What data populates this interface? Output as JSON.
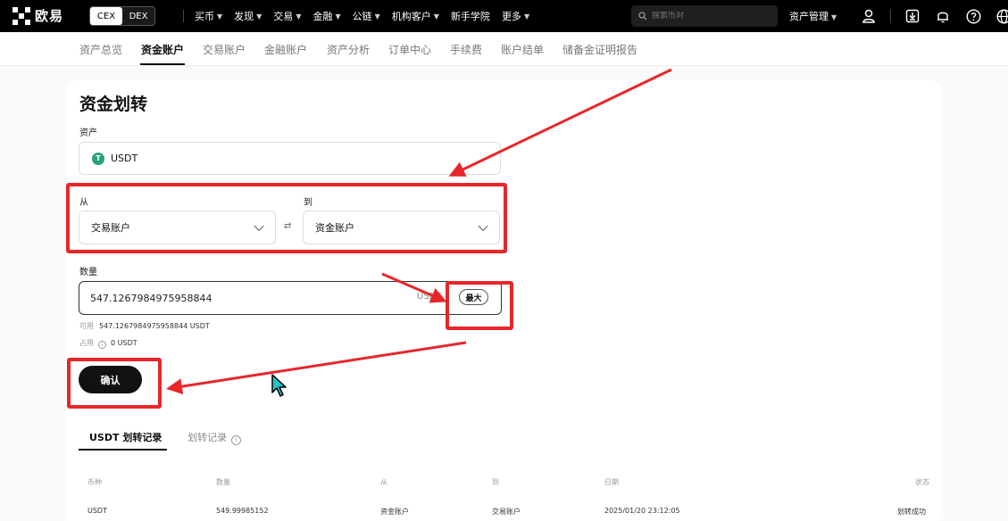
{
  "brand": {
    "name": "欧易"
  },
  "mode_toggle": {
    "cex": "CEX",
    "dex": "DEX"
  },
  "top_menu": [
    {
      "label": "买币",
      "chevron": true
    },
    {
      "label": "发现",
      "chevron": true
    },
    {
      "label": "交易",
      "chevron": true
    },
    {
      "label": "金融",
      "chevron": true
    },
    {
      "label": "公链",
      "chevron": true
    },
    {
      "label": "机构客户",
      "chevron": true
    },
    {
      "label": "新手学院",
      "chevron": false
    },
    {
      "label": "更多",
      "chevron": true
    }
  ],
  "search": {
    "placeholder": "搜索币对"
  },
  "asset_management": "资产管理",
  "nav_icons": [
    "user-icon",
    "download-icon",
    "bell-icon",
    "help-icon",
    "globe-icon"
  ],
  "sub_nav": [
    "资产总览",
    "资金账户",
    "交易账户",
    "金融账户",
    "资产分析",
    "订单中心",
    "手续费",
    "账户结单",
    "储备金证明报告"
  ],
  "sub_nav_active": "资金账户",
  "transfer": {
    "title": "资金划转",
    "asset_label": "资产",
    "asset_value": "USDT",
    "asset_icon_letter": "T",
    "from_label": "从",
    "from_value": "交易账户",
    "to_label": "到",
    "to_value": "资金账户",
    "swap_symbol": "⇄",
    "amount_label": "数量",
    "amount_value": "547.1267984975958844",
    "amount_unit": "USDT",
    "max_button": "最大",
    "available_label": "可用",
    "available_value": "547.1267984975958844 USDT",
    "occupied_label": "占用",
    "occupied_value": "0 USDT",
    "confirm_button": "确认"
  },
  "history": {
    "tabs": [
      "USDT 划转记录",
      "划转记录"
    ],
    "columns": [
      "币种",
      "数量",
      "从",
      "到",
      "日期",
      "状态"
    ],
    "rows": [
      [
        "USDT",
        "549.99985152",
        "资金账户",
        "交易账户",
        "2025/01/20 23:12:05",
        "划转成功"
      ]
    ]
  },
  "colors": {
    "annotation_red": "#e8262a",
    "usdt_green": "#26a17b",
    "nav_bg": "#000000"
  }
}
